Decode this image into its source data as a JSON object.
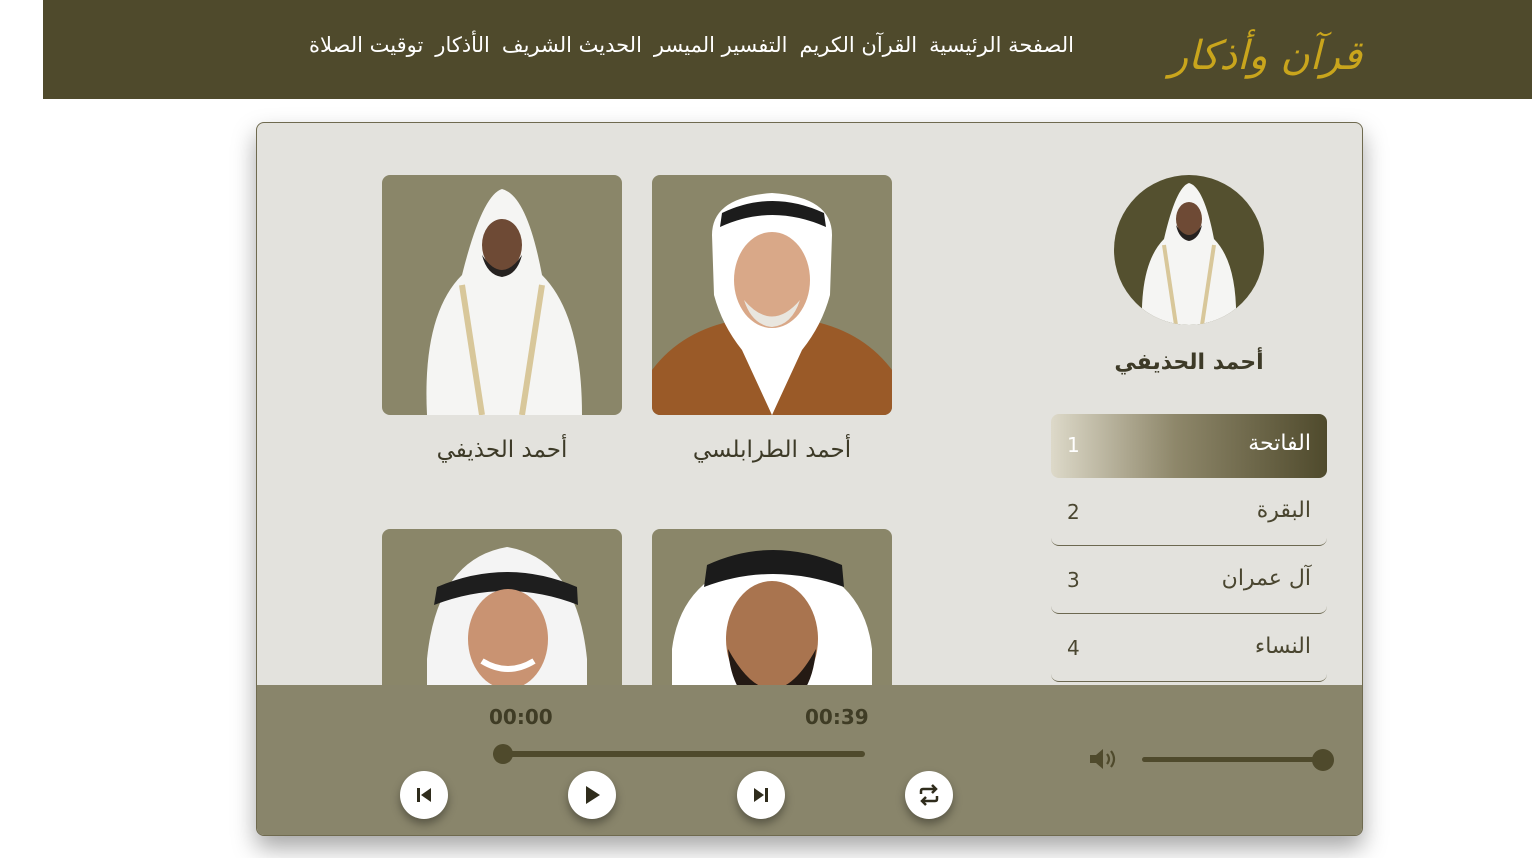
{
  "header": {
    "logo": "قرآن وأذكار",
    "nav": [
      "الصفحة الرئيسية",
      "القرآن الكريم",
      "التفسير الميسر",
      "الحديث الشريف",
      "الأذكار",
      "توقيت الصلاة"
    ]
  },
  "sidebar": {
    "current_reciter": "أحمد الحذيفي",
    "surahs": [
      {
        "name": "الفاتحة",
        "num": "1"
      },
      {
        "name": "البقرة",
        "num": "2"
      },
      {
        "name": "آل عمران",
        "num": "3"
      },
      {
        "name": "النساء",
        "num": "4"
      }
    ]
  },
  "reciters": [
    {
      "name": "أحمد الطرابلسي"
    },
    {
      "name": "أحمد الحذيفي"
    },
    {
      "name": ""
    },
    {
      "name": ""
    }
  ],
  "player": {
    "current_time": "00:00",
    "duration": "00:39",
    "progress_fraction": 0,
    "volume_fraction": 1,
    "icons": [
      "previous-icon",
      "play-icon",
      "next-icon",
      "repeat-icon",
      "volume-icon"
    ]
  },
  "colors": {
    "header_bg": "#4f4a2c",
    "logo": "#c9a51c",
    "card_bg": "#e3e2dd",
    "player_bg": "#89856b",
    "photo_bg": "#8a8669"
  }
}
